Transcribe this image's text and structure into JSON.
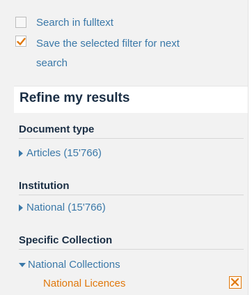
{
  "options": {
    "fulltext": {
      "label": "Search in fulltext",
      "checked": false
    },
    "save_filter": {
      "label_line1": "Save the selected filter for next",
      "label_line2": "search",
      "checked": true
    }
  },
  "refine": {
    "title": "Refine my results"
  },
  "facets": {
    "document_type": {
      "title": "Document type",
      "item": "Articles (15'766)"
    },
    "institution": {
      "title": "Institution",
      "item": "National (15'766)"
    },
    "specific_collection": {
      "title": "Specific Collection",
      "parent": "National Collections",
      "active_item": "National Licences"
    }
  },
  "icons": {
    "checkmark": "checkmark-icon",
    "expand": "triangle-right-icon",
    "collapse": "triangle-down-icon",
    "remove": "close-icon"
  },
  "colors": {
    "link": "#3a78a8",
    "heading": "#1a2e44",
    "active": "#e0780c",
    "panel": "#f2f2f2"
  }
}
